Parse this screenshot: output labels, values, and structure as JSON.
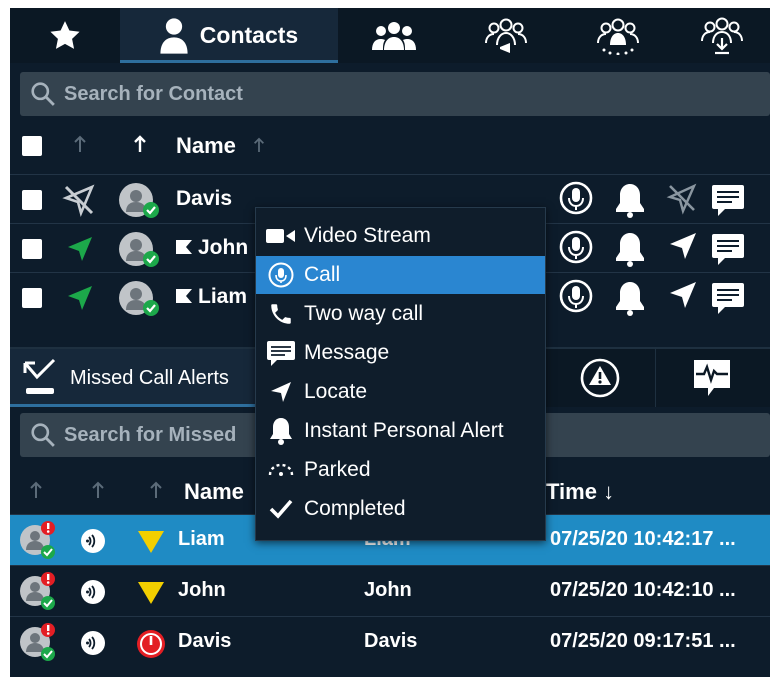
{
  "top_tabs": [
    {
      "icon": "star-icon"
    },
    {
      "icon": "person-icon",
      "label": "Contacts"
    },
    {
      "icon": "group-icon"
    },
    {
      "icon": "group-broadcast-icon"
    },
    {
      "icon": "group-sparkle-icon"
    },
    {
      "icon": "group-download-icon"
    }
  ],
  "contacts": {
    "search_placeholder": "Search for Contact",
    "name_header": "Name",
    "rows": [
      {
        "name": "Davis",
        "location": "no-location",
        "flagged": false
      },
      {
        "name": "John",
        "location": "location-on",
        "flagged": true
      },
      {
        "name": "Liam",
        "location": "location-on",
        "flagged": true
      }
    ]
  },
  "context_menu": {
    "items": [
      {
        "label": "Video Stream",
        "icon": "video-camera-icon"
      },
      {
        "label": "Call",
        "icon": "microphone-icon",
        "highlighted": true
      },
      {
        "label": "Two way call",
        "icon": "phone-icon"
      },
      {
        "label": "Message",
        "icon": "message-icon"
      },
      {
        "label": "Locate",
        "icon": "locate-arrow-icon"
      },
      {
        "label": "Instant Personal Alert",
        "icon": "bell-icon"
      },
      {
        "label": "Parked",
        "icon": "parked-icon"
      },
      {
        "label": "Completed",
        "icon": "checkmark-icon"
      }
    ]
  },
  "missed_tabs": [
    {
      "icon": "missed-call-icon",
      "label": "Missed Call Alerts"
    },
    {
      "icon": "warning-icon"
    },
    {
      "icon": "heartbeat-icon"
    }
  ],
  "missed": {
    "search_placeholder": "Search for Missed",
    "name_header": "Name",
    "time_header": "Time ↓",
    "rows": [
      {
        "name": "Liam",
        "name2": "Liam",
        "time": "07/25/20 10:42:17 ...",
        "priority": "low",
        "selected": true
      },
      {
        "name": "John",
        "name2": "John",
        "time": "07/25/20 10:42:10 ...",
        "priority": "low",
        "selected": false
      },
      {
        "name": "Davis",
        "name2": "Davis",
        "time": "07/25/20 09:17:51 ...",
        "priority": "high",
        "selected": false
      }
    ]
  },
  "colors": {
    "background": "#0d1c2b",
    "accent": "#2e6f9e",
    "selected_row": "#1f8bc4",
    "menu_highlight": "#2a86d1",
    "location_green": "#1ca84a",
    "warning_yellow": "#f2cf00",
    "alert_red": "#e31e24"
  }
}
